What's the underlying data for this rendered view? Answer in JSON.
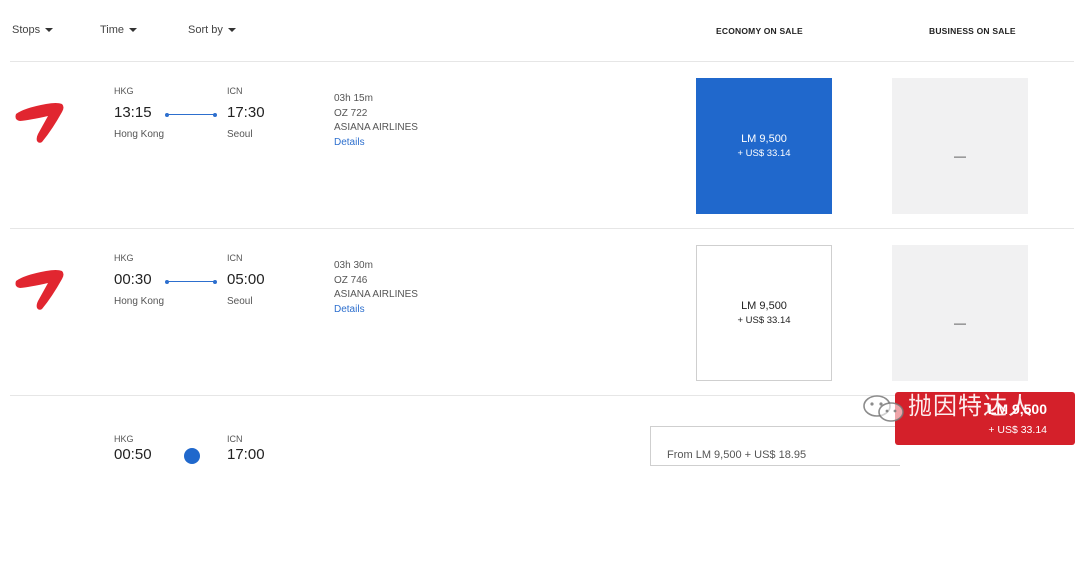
{
  "filters": {
    "stops": "Stops",
    "time": "Time",
    "sort": "Sort by"
  },
  "columns": {
    "economy": "ECONOMY ON SALE",
    "business": "BUSINESS ON SALE"
  },
  "flights": [
    {
      "from_code": "HKG",
      "depart": "13:15",
      "from_city": "Hong Kong",
      "to_code": "ICN",
      "arrive": "17:30",
      "to_city": "Seoul",
      "duration": "03h 15m",
      "flight_no": "OZ 722",
      "airline": "ASIANA AIRLINES",
      "details": "Details",
      "economy": {
        "miles": "LM 9,500",
        "tax": "+ US$ 33.14",
        "selected": true
      },
      "business": {
        "value": "—"
      }
    },
    {
      "from_code": "HKG",
      "depart": "00:30",
      "from_city": "Hong Kong",
      "to_code": "ICN",
      "arrive": "05:00",
      "to_city": "Seoul",
      "duration": "03h 30m",
      "flight_no": "OZ 746",
      "airline": "ASIANA AIRLINES",
      "details": "Details",
      "economy": {
        "miles": "LM 9,500",
        "tax": "+ US$ 33.14",
        "selected": false
      },
      "business": {
        "value": "—"
      }
    },
    {
      "from_code": "HKG",
      "depart": "00:50",
      "to_code": "ICN",
      "arrive": "17:00",
      "partial_fare": "From LM 9,500 + US$ 18.95"
    }
  ],
  "selection_bar": {
    "miles": "LM 9,500",
    "tax": "+ US$ 33.14"
  },
  "watermark": {
    "text": "抛因特达人",
    "icon": "wechat-icon"
  },
  "colors": {
    "accent_blue": "#2068cc",
    "brand_red": "#d4202a",
    "logo_red": "#e12630"
  }
}
